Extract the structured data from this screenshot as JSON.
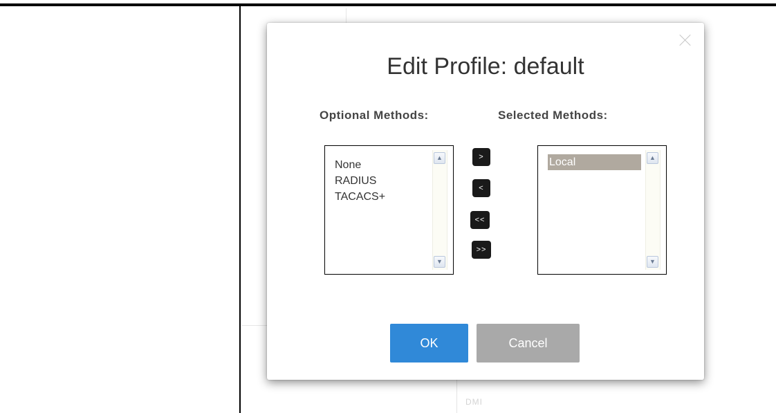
{
  "background": {
    "fragment_text": "DMI"
  },
  "dialog": {
    "title": "Edit Profile: default",
    "close_icon": "close-icon",
    "optional": {
      "label": "Optional Methods:",
      "items": [
        "None",
        "RADIUS",
        "TACACS+"
      ]
    },
    "selected": {
      "label": "Selected Methods:",
      "items": [
        "Local"
      ],
      "highlighted_index": 0
    },
    "move_buttons": {
      "add": ">",
      "remove": "<",
      "remove_all": "<<",
      "add_all": ">>"
    },
    "buttons": {
      "ok": "OK",
      "cancel": "Cancel"
    },
    "colors": {
      "ok": "#3089d8",
      "cancel": "#a9a9a9",
      "selection": "#b0a99f",
      "move_button": "#1a1a1a"
    }
  }
}
